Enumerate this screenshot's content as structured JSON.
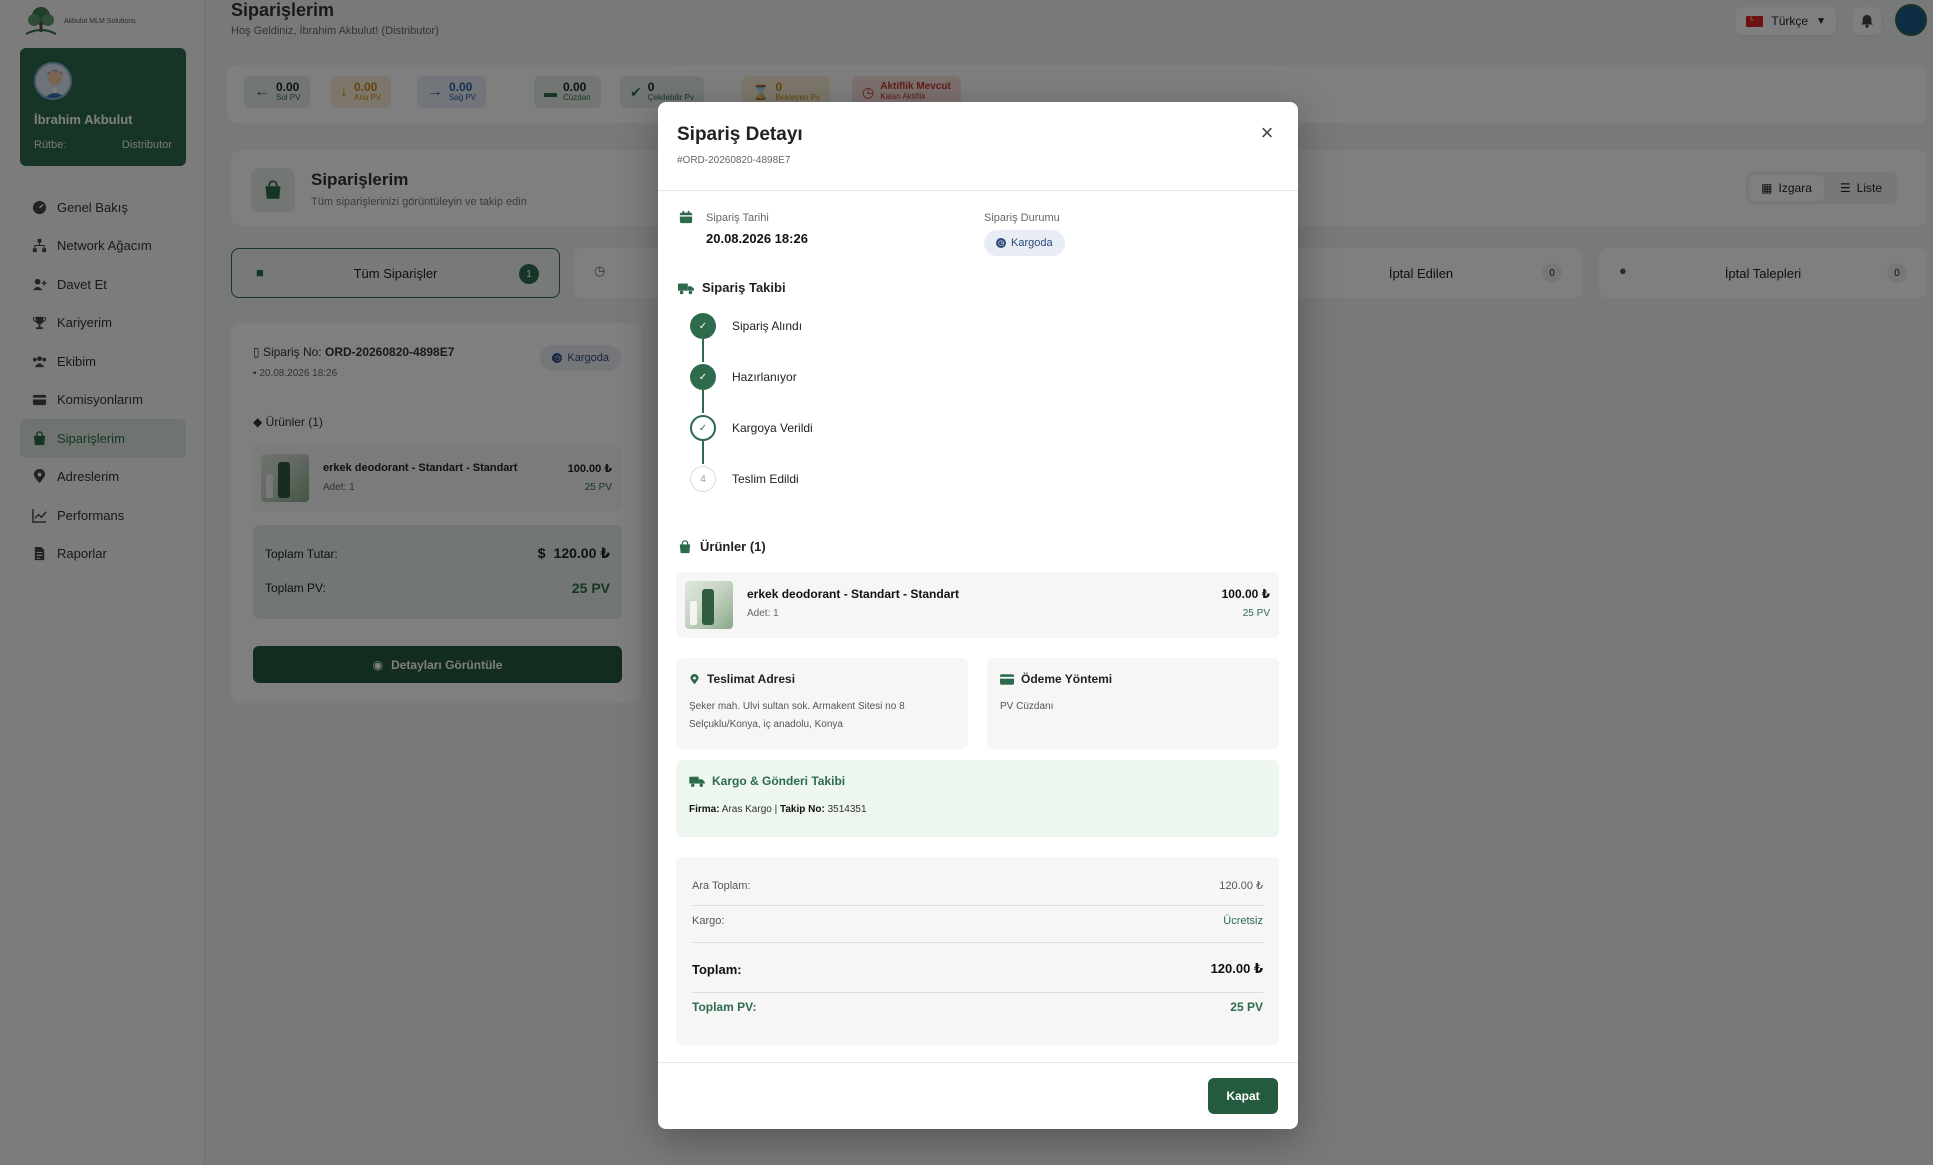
{
  "app": {
    "logo_text": "Akbulut MLM Solutions"
  },
  "profile": {
    "name": "İbrahim Akbulut",
    "rank_label": "Rütbe:",
    "rank_value": "Distributor"
  },
  "sidebar": {
    "items": [
      {
        "label": "Genel Bakış",
        "icon": "dashboard-icon"
      },
      {
        "label": "Network Ağacım",
        "icon": "network-icon"
      },
      {
        "label": "Davet Et",
        "icon": "user-plus-icon"
      },
      {
        "label": "Kariyerim",
        "icon": "trophy-icon"
      },
      {
        "label": "Ekibim",
        "icon": "team-icon"
      },
      {
        "label": "Komisyonlarım",
        "icon": "wallet-icon"
      },
      {
        "label": "Siparişlerim",
        "icon": "bag-icon",
        "active": true
      },
      {
        "label": "Adreslerim",
        "icon": "map-pin-icon"
      },
      {
        "label": "Performans",
        "icon": "chart-line-icon"
      },
      {
        "label": "Raporlar",
        "icon": "document-icon"
      }
    ]
  },
  "header": {
    "title": "Siparişlerim",
    "welcome": "Hoş Geldiniz, İbrahim Akbulut! (Distributor)",
    "language": "Türkçe"
  },
  "stats": [
    {
      "value": "0.00",
      "label": "Sol PV",
      "color": "#2e6b4d"
    },
    {
      "value": "0.00",
      "label": "Ana PV",
      "color": "#c98a1a"
    },
    {
      "value": "0.00",
      "label": "Sağ PV",
      "color": "#2c5aa0"
    },
    {
      "value": "0.00",
      "label": "Cüzdan",
      "color": "#2e6b4d"
    },
    {
      "value": "0",
      "label": "Çekilebilir Pv",
      "color": "#2e6b4d"
    },
    {
      "value": "0",
      "label": "Bekleyen Pv",
      "color": "#c98a1a"
    },
    {
      "value": "Aktiflik Mevcut",
      "label": "Kalan Aktiflik",
      "color": "#c0392b"
    }
  ],
  "orders_page": {
    "title": "Siparişlerim",
    "subtitle": "Tüm siparişlerinizi görüntüleyin ve takip edin",
    "view_grid": "Izgara",
    "view_list": "Liste",
    "tabs": [
      {
        "label": "Tüm Siparişler",
        "count": "1"
      },
      {
        "label": "İptal Edilen",
        "count": "0"
      },
      {
        "label": "İptal Talepleri",
        "count": "0"
      }
    ]
  },
  "order_card": {
    "order_no_label": "Sipariş No:",
    "order_no": "ORD-20260820-4898E7",
    "date": "20.08.2026 18:26",
    "status": "Kargoda",
    "products_title": "Ürünler (1)",
    "product_name": "erkek deodorant - Standart - Standart",
    "product_qty": "Adet: 1",
    "product_price": "100.00 ₺",
    "product_pv": "25 PV",
    "total_label": "Toplam Tutar:",
    "total_value": "120.00 ₺",
    "total_pv_label": "Toplam PV:",
    "total_pv_value": "25 PV",
    "details_button": "Detayları Görüntüle"
  },
  "modal": {
    "title": "Sipariş Detayı",
    "order_ref": "#ORD-20260820-4898E7",
    "date_label": "Sipariş Tarihi",
    "date_value": "20.08.2026 18:26",
    "status_label": "Sipariş Durumu",
    "status_value": "Kargoda",
    "tracking_title": "Sipariş Takibi",
    "steps": [
      {
        "label": "Sipariş Alındı",
        "state": "done",
        "mark": "✓"
      },
      {
        "label": "Hazırlanıyor",
        "state": "done",
        "mark": "✓"
      },
      {
        "label": "Kargoya Verildi",
        "state": "current",
        "mark": "✓"
      },
      {
        "label": "Teslim Edildi",
        "state": "todo",
        "mark": "4"
      }
    ],
    "products_title": "Ürünler (1)",
    "product": {
      "name": "erkek deodorant - Standart - Standart",
      "qty": "Adet: 1",
      "price": "100.00 ₺",
      "pv": "25 PV"
    },
    "address_title": "Teslimat Adresi",
    "address_line1": "Şeker mah. Ulvi sultan sok. Armakent Sitesi no 8",
    "address_line2": "Selçuklu/Konya, iç anadolu, Konya",
    "payment_title": "Ödeme Yöntemi",
    "payment_value": "PV Cüzdanı",
    "cargo_title": "Kargo & Gönderi Takibi",
    "cargo_firm_label": "Firma:",
    "cargo_firm": "Aras Kargo",
    "cargo_sep": "|",
    "cargo_track_label": "Takip No:",
    "cargo_track": "3514351",
    "subtotal_label": "Ara Toplam:",
    "subtotal_value": "120.00 ₺",
    "shipping_label": "Kargo:",
    "shipping_value": "Ücretsiz",
    "total_label": "Toplam:",
    "total_value": "120.00 ₺",
    "total_pv_label": "Toplam PV:",
    "total_pv_value": "25 PV",
    "close_button": "Kapat"
  }
}
